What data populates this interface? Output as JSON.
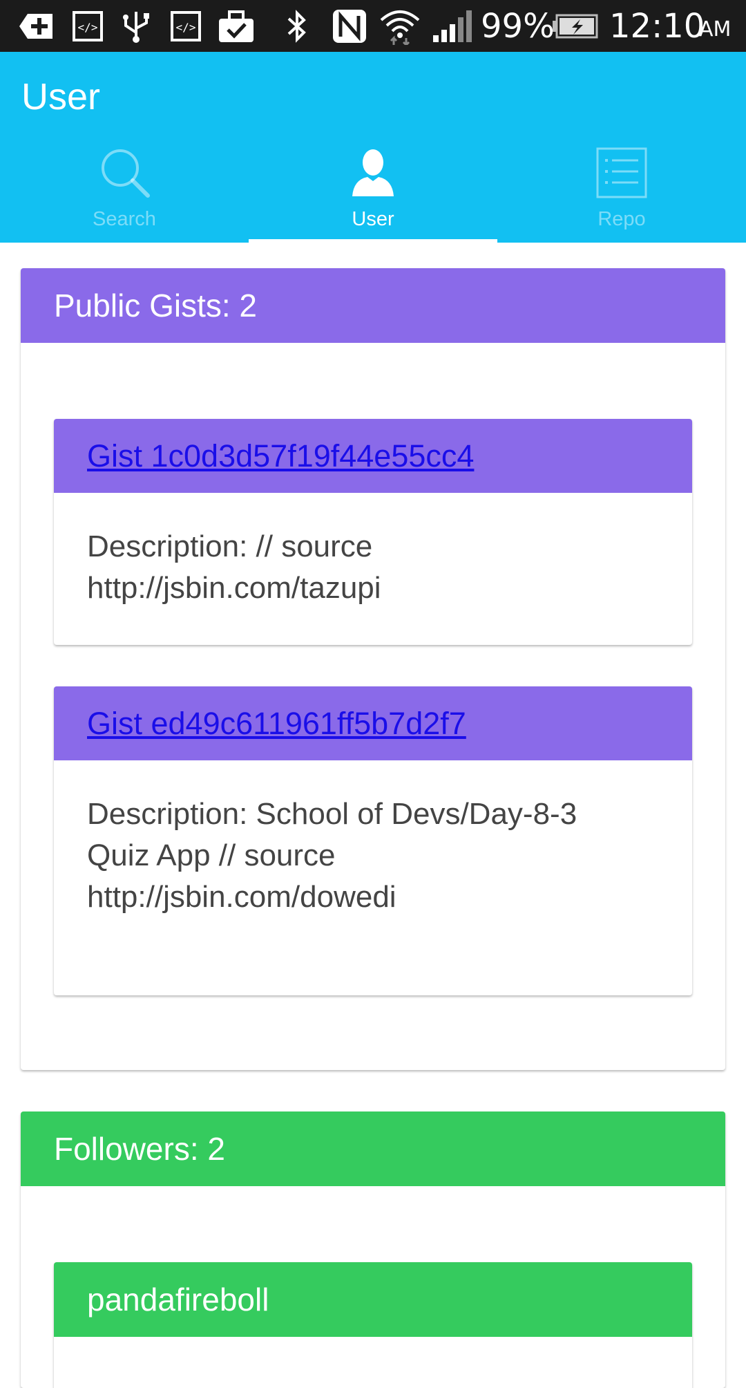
{
  "status_bar": {
    "battery": "99%",
    "time": "12:10",
    "ampm": "AM",
    "icons": [
      "add-notification-icon",
      "code-icon",
      "usb-icon",
      "code-icon",
      "briefcase-check-icon",
      "bluetooth-icon",
      "nfc-icon",
      "wifi-icon",
      "signal-icon",
      "battery-charging-icon"
    ]
  },
  "app_bar": {
    "title": "User",
    "background": "#12c0f2"
  },
  "tabs": [
    {
      "label": "Search",
      "icon": "search-icon",
      "active": false
    },
    {
      "label": "User",
      "icon": "user-icon",
      "active": true
    },
    {
      "label": "Repo",
      "icon": "list-icon",
      "active": false
    }
  ],
  "gists": {
    "header": "Public Gists: 2",
    "color": "#8a6ae9",
    "items": [
      {
        "title": "Gist 1c0d3d57f19f44e55cc4",
        "description_lines": [
          "Description: // source",
          "http://jsbin.com/tazupi"
        ]
      },
      {
        "title": "Gist ed49c611961ff5b7d2f7",
        "description_lines": [
          "Description: School of Devs/Day-8-3",
          "Quiz App // source",
          "http://jsbin.com/dowedi"
        ]
      }
    ]
  },
  "followers": {
    "header": "Followers: 2",
    "color": "#35cb5e",
    "items": [
      {
        "login": "pandafireboll"
      }
    ]
  },
  "link_color": "#1a0ee8"
}
